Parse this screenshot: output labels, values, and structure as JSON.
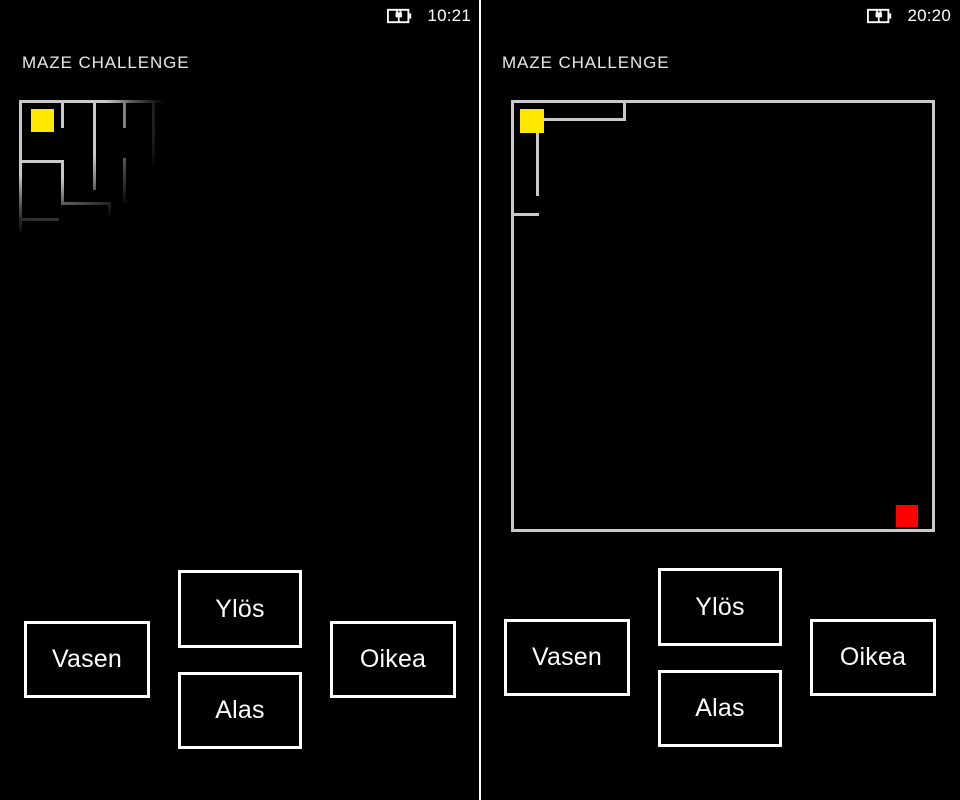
{
  "app": {
    "title": "MAZE CHALLENGE"
  },
  "panels": [
    {
      "id": "left",
      "status": {
        "time": "10:21",
        "battery_icon": "battery-charging-icon"
      },
      "title": "MAZE CHALLENGE",
      "maze": {
        "start_cell_color": "#ffe800",
        "goal_cell_color": "#fe0000",
        "wall_color": "#c9c9c9",
        "background_color": "#000000",
        "render_state": "partially-drawn"
      },
      "controls": {
        "left": "Vasen",
        "up": "Ylös",
        "down": "Alas",
        "right": "Oikea"
      }
    },
    {
      "id": "right",
      "status": {
        "time": "20:20",
        "battery_icon": "battery-charging-icon"
      },
      "title": "MAZE CHALLENGE",
      "maze": {
        "start_cell_color": "#ffe800",
        "goal_cell_color": "#fe0000",
        "wall_color": "#c9c9c9",
        "background_color": "#000000",
        "render_state": "drawn"
      },
      "controls": {
        "left": "Vasen",
        "up": "Ylös",
        "down": "Alas",
        "right": "Oikea"
      }
    }
  ]
}
